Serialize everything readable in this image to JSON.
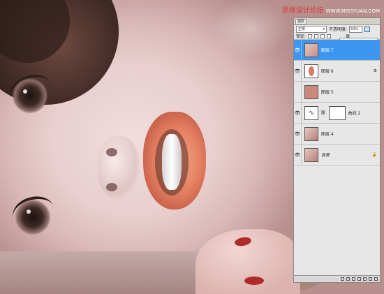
{
  "watermark": {
    "site": "思缘设计论坛",
    "url": "WWW.MISSYUAN.COM"
  },
  "layers_panel": {
    "tab_label": "图层",
    "blend_mode": "正常",
    "opacity_label": "不透明度:",
    "opacity_value": "50%",
    "lock_label": "锁定:",
    "fill_label": "填",
    "layers": [
      {
        "name": "图层 7",
        "selected": true,
        "thumb": "photo"
      },
      {
        "name": "图层 6",
        "selected": false,
        "thumb": "lips-mask"
      },
      {
        "name": "图层 5",
        "selected": false,
        "thumb": "solid",
        "color": "#c98a7c"
      },
      {
        "name": "曲线 2",
        "selected": false,
        "thumb": "curves"
      },
      {
        "name": "图层 4",
        "selected": false,
        "thumb": "photo"
      },
      {
        "name": "背景",
        "selected": false,
        "thumb": "photo",
        "locked": true
      }
    ],
    "accent_color": "#3d96f0"
  }
}
